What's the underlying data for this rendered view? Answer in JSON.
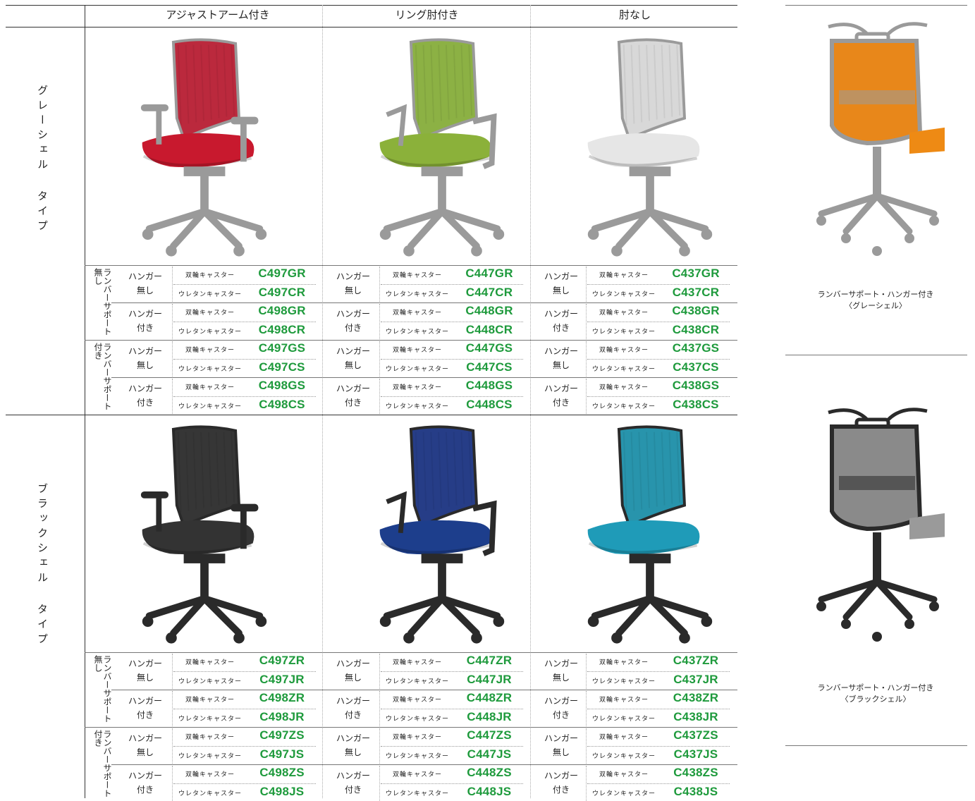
{
  "columns": [
    "アジャストアーム付き",
    "リング肘付き",
    "肘なし"
  ],
  "shells": [
    {
      "type_label": "グレーシェル タイプ",
      "chair_colors": {
        "frame": "#9a9a9a",
        "seats": [
          "#c8192e",
          "#8bb13a",
          "#e6e6e6"
        ],
        "backs": [
          "#b71d33",
          "#86ad3a",
          "#d6d6d6"
        ]
      },
      "lumbar_groups": [
        {
          "label": "ランバーサポート無し",
          "hanger_rows": [
            {
              "label_a": "ハンガー",
              "label_b": "無し",
              "codes": [
                [
                  "C497GR",
                  "C497CR"
                ],
                [
                  "C447GR",
                  "C447CR"
                ],
                [
                  "C437GR",
                  "C437CR"
                ]
              ]
            },
            {
              "label_a": "ハンガー",
              "label_b": "付き",
              "codes": [
                [
                  "C498GR",
                  "C498CR"
                ],
                [
                  "C448GR",
                  "C448CR"
                ],
                [
                  "C438GR",
                  "C438CR"
                ]
              ]
            }
          ]
        },
        {
          "label": "ランバーサポート付き",
          "hanger_rows": [
            {
              "label_a": "ハンガー",
              "label_b": "無し",
              "codes": [
                [
                  "C497GS",
                  "C497CS"
                ],
                [
                  "C447GS",
                  "C447CS"
                ],
                [
                  "C437GS",
                  "C437CS"
                ]
              ]
            },
            {
              "label_a": "ハンガー",
              "label_b": "付き",
              "codes": [
                [
                  "C498GS",
                  "C498CS"
                ],
                [
                  "C448GS",
                  "C448CS"
                ],
                [
                  "C438GS",
                  "C438CS"
                ]
              ]
            }
          ]
        }
      ]
    },
    {
      "type_label": "ブラックシェル タイプ",
      "chair_colors": {
        "frame": "#2a2a2a",
        "seats": [
          "#333333",
          "#1d3e8c",
          "#1f9bb8"
        ],
        "backs": [
          "#2b2b2b",
          "#1a3381",
          "#1c8ea8"
        ]
      },
      "lumbar_groups": [
        {
          "label": "ランバーサポート無し",
          "hanger_rows": [
            {
              "label_a": "ハンガー",
              "label_b": "無し",
              "codes": [
                [
                  "C497ZR",
                  "C497JR"
                ],
                [
                  "C447ZR",
                  "C447JR"
                ],
                [
                  "C437ZR",
                  "C437JR"
                ]
              ]
            },
            {
              "label_a": "ハンガー",
              "label_b": "付き",
              "codes": [
                [
                  "C498ZR",
                  "C498JR"
                ],
                [
                  "C448ZR",
                  "C448JR"
                ],
                [
                  "C438ZR",
                  "C438JR"
                ]
              ]
            }
          ]
        },
        {
          "label": "ランバーサポート付き",
          "hanger_rows": [
            {
              "label_a": "ハンガー",
              "label_b": "無し",
              "codes": [
                [
                  "C497ZS",
                  "C497JS"
                ],
                [
                  "C447ZS",
                  "C447JS"
                ],
                [
                  "C437ZS",
                  "C437JS"
                ]
              ]
            },
            {
              "label_a": "ハンガー",
              "label_b": "付き",
              "codes": [
                [
                  "C498ZS",
                  "C498JS"
                ],
                [
                  "C448ZS",
                  "C448JS"
                ],
                [
                  "C438ZS",
                  "C438JS"
                ]
              ]
            }
          ]
        }
      ]
    }
  ],
  "casters": [
    "双輪キャスター",
    "ウレタンキャスター"
  ],
  "side_panels": [
    {
      "caption_1": "ランバーサポート・ハンガー付き",
      "caption_2": "〈グレーシェル〉",
      "colors": {
        "frame": "#9a9a9a",
        "back": "#e8871a",
        "seat": "#ee8a14"
      }
    },
    {
      "caption_1": "ランバーサポート・ハンガー付き",
      "caption_2": "〈ブラックシェル〉",
      "colors": {
        "frame": "#2a2a2a",
        "back": "#8a8a8a",
        "seat": "#9a9a9a"
      }
    }
  ],
  "colors": {
    "code_green": "#1e9a3c"
  }
}
